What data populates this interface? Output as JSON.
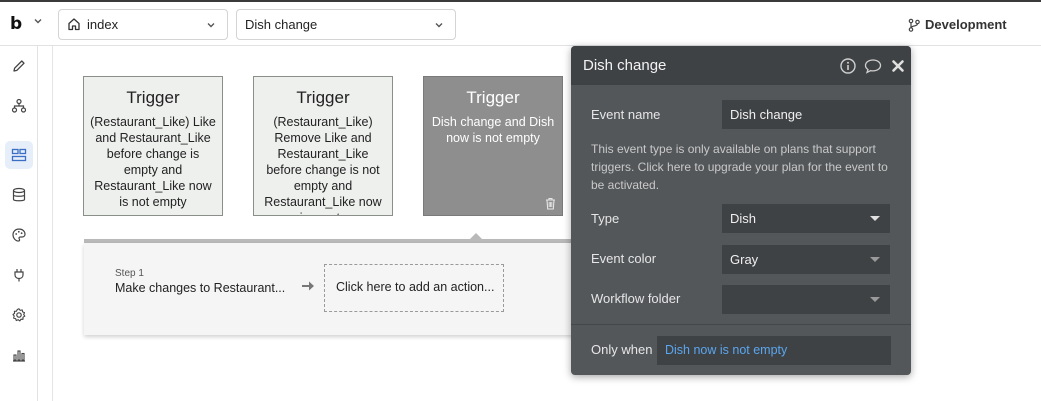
{
  "topbar": {
    "logo": "b",
    "page_dropdown": {
      "value": "index"
    },
    "event_dropdown": {
      "value": "Dish change"
    },
    "branch_button": {
      "label": "Development"
    }
  },
  "sidebar": {
    "items": [
      {
        "name": "design",
        "icon": "pencil-icon"
      },
      {
        "name": "data-structure",
        "icon": "hierarchy-icon"
      },
      {
        "name": "workflow",
        "icon": "workflow-icon",
        "active": true
      },
      {
        "name": "data",
        "icon": "database-icon"
      },
      {
        "name": "styles",
        "icon": "palette-icon"
      },
      {
        "name": "plugins",
        "icon": "plug-icon"
      },
      {
        "name": "settings",
        "icon": "gear-icon"
      },
      {
        "name": "logs",
        "icon": "chart-icon"
      }
    ]
  },
  "triggers": [
    {
      "title": "Trigger",
      "description": "(Restaurant_Like) Like and Restaurant_Like before change is empty and Restaurant_Like now is not empty"
    },
    {
      "title": "Trigger",
      "description": "(Restaurant_Like) Remove Like and Restaurant_Like before change is not empty and Restaurant_Like now is empty"
    },
    {
      "title": "Trigger",
      "description": "Dish change and Dish now is not empty",
      "selected": true
    }
  ],
  "step": {
    "number_label": "Step 1",
    "name": "Make changes to Restaurant...",
    "add_action_label": "Click here to add an action..."
  },
  "property_editor": {
    "title": "Dish change",
    "event_name_label": "Event name",
    "event_name_value": "Dish change",
    "note": "This event type is only available on plans that support triggers. Click here to upgrade your plan for the event to be activated.",
    "type_label": "Type",
    "type_value": "Dish",
    "color_label": "Event color",
    "color_value": "Gray",
    "folder_label": "Workflow folder",
    "folder_value": "",
    "only_when_label": "Only when",
    "only_when_value": "Dish now is not empty"
  },
  "colors": {
    "panel_bg": "#53575a",
    "panel_header": "#3f4245",
    "condition_link": "#5aa6ef",
    "selected_trigger": "#8e8e8e",
    "active_sidebar": "#e6eef9"
  }
}
